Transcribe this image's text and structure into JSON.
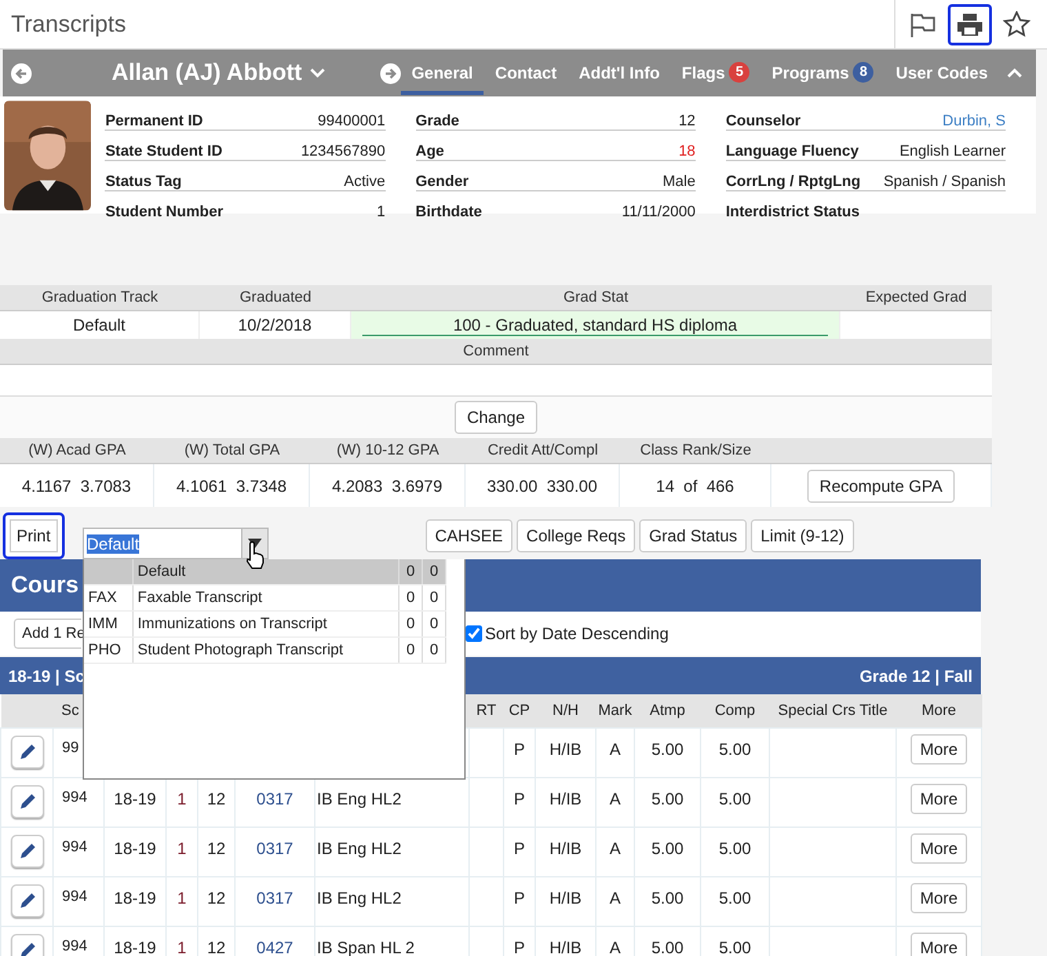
{
  "page_title": "Transcripts",
  "header_icons": [
    {
      "kind": "flag",
      "highlighted": false
    },
    {
      "kind": "print",
      "highlighted": true
    },
    {
      "kind": "star",
      "highlighted": false
    }
  ],
  "student_bar": {
    "name": "Allan (AJ) Abbott",
    "tabs": [
      {
        "label": "General",
        "selected": true
      },
      {
        "label": "Contact",
        "selected": false
      },
      {
        "label": "Addt'l Info",
        "selected": false
      },
      {
        "label": "Flags",
        "selected": false,
        "badge": "5",
        "color": "#d9413e"
      },
      {
        "label": "Programs",
        "selected": false,
        "badge": "8",
        "color": "#3d5fa0"
      },
      {
        "label": "User Codes",
        "selected": false
      }
    ]
  },
  "student_info": [
    [
      {
        "label": "Permanent ID",
        "value": "99400001",
        "kind": "text"
      },
      {
        "label": "State Student ID",
        "value": "1234567890",
        "kind": "text"
      },
      {
        "label": "Status Tag",
        "value": "Active",
        "kind": "text"
      },
      {
        "label": "Student Number",
        "value": "1",
        "kind": "text"
      }
    ],
    [
      {
        "label": "Grade",
        "value": "12",
        "kind": "text"
      },
      {
        "label": "Age",
        "value": "18",
        "kind": "alert"
      },
      {
        "label": "Gender",
        "value": "Male",
        "kind": "text"
      },
      {
        "label": "Birthdate",
        "value": "11/11/2000",
        "kind": "text"
      }
    ],
    [
      {
        "label": "Counselor",
        "value": "Durbin, S",
        "kind": "link"
      },
      {
        "label": "Language Fluency",
        "value": "English Learner",
        "kind": "text"
      },
      {
        "label": "CorrLng / RptgLng",
        "value": "Spanish / Spanish",
        "kind": "text"
      },
      {
        "label": "Interdistrict Status"
      }
    ]
  ],
  "graduation": {
    "columns": [
      "Graduation Track",
      "Graduated",
      "Grad Stat",
      "Expected Grad"
    ],
    "values": [
      "Default",
      "10/2/2018",
      "100 - Graduated, standard HS diploma"
    ],
    "comment_label": "Comment",
    "change_button": "Change"
  },
  "gpa": {
    "columns": [
      "(W) Acad GPA",
      "(W) Total GPA",
      "(W) 10-12 GPA",
      "Credit Att/Compl",
      "Class Rank/Size"
    ],
    "values": [
      [
        "4.1167",
        "3.7083"
      ],
      [
        "4.1061",
        "3.7348"
      ],
      [
        "4.2083",
        "3.6979"
      ],
      [
        "330.00",
        "330.00"
      ],
      [
        "14",
        "of",
        "466"
      ]
    ],
    "recompute_button": "Recompute GPA"
  },
  "toolbar": {
    "print_button": {
      "label": "Print",
      "highlighted": true
    },
    "transcript_select": {
      "value": "Default",
      "text_selected": true
    },
    "buttons": [
      "CAHSEE",
      "College Reqs",
      "Grad Status",
      "Limit (9-12)"
    ]
  },
  "dropdown_options": [
    {
      "name": "Default",
      "col_1": "0",
      "col_2": "0",
      "selected": true
    },
    {
      "code": "FAX",
      "name": "Faxable Transcript",
      "col_1": "0",
      "col_2": "0",
      "selected": false
    },
    {
      "code": "IMM",
      "name": "Immunizations on Transcript",
      "col_1": "0",
      "col_2": "0",
      "selected": false
    },
    {
      "code": "PHO",
      "name": "Student Photograph Transcript",
      "col_1": "0",
      "col_2": "0",
      "selected": false
    }
  ],
  "courses": {
    "title": "Cours",
    "add_button": "Add 1 Re",
    "sort_checkbox": {
      "label": "Sort by Date Descending",
      "checked": true
    },
    "section": {
      "left": "18-19 | Sc",
      "right": "Grade 12 | Fall"
    },
    "columns": [
      "Sc",
      null,
      null,
      null,
      null,
      null,
      "RT",
      "CP",
      "N/H",
      "Mark",
      "Atmp",
      "Comp",
      "Special Crs Title"
    ],
    "more_column": "More",
    "rows": [
      {
        "cells": [
          "99",
          null,
          null,
          null,
          null,
          null,
          "",
          "P",
          "H/IB",
          "A",
          "5.00",
          "5.00",
          ""
        ],
        "more": "More"
      },
      {
        "cells": [
          "994",
          "18-19",
          "1",
          "12",
          "0317",
          "IB Eng HL2",
          "",
          "P",
          "H/IB",
          "A",
          "5.00",
          "5.00",
          ""
        ],
        "more": "More"
      },
      {
        "cells": [
          "994",
          "18-19",
          "1",
          "12",
          "0317",
          "IB Eng HL2",
          "",
          "P",
          "H/IB",
          "A",
          "5.00",
          "5.00",
          ""
        ],
        "more": "More"
      },
      {
        "cells": [
          "994",
          "18-19",
          "1",
          "12",
          "0317",
          "IB Eng HL2",
          "",
          "P",
          "H/IB",
          "A",
          "5.00",
          "5.00",
          ""
        ],
        "more": "More"
      },
      {
        "cells": [
          "994",
          "18-19",
          "1",
          "12",
          "0427",
          "IB Span HL 2",
          "",
          "P",
          "H/IB",
          "A",
          "5.00",
          "5.00",
          ""
        ],
        "more": "More"
      }
    ]
  }
}
